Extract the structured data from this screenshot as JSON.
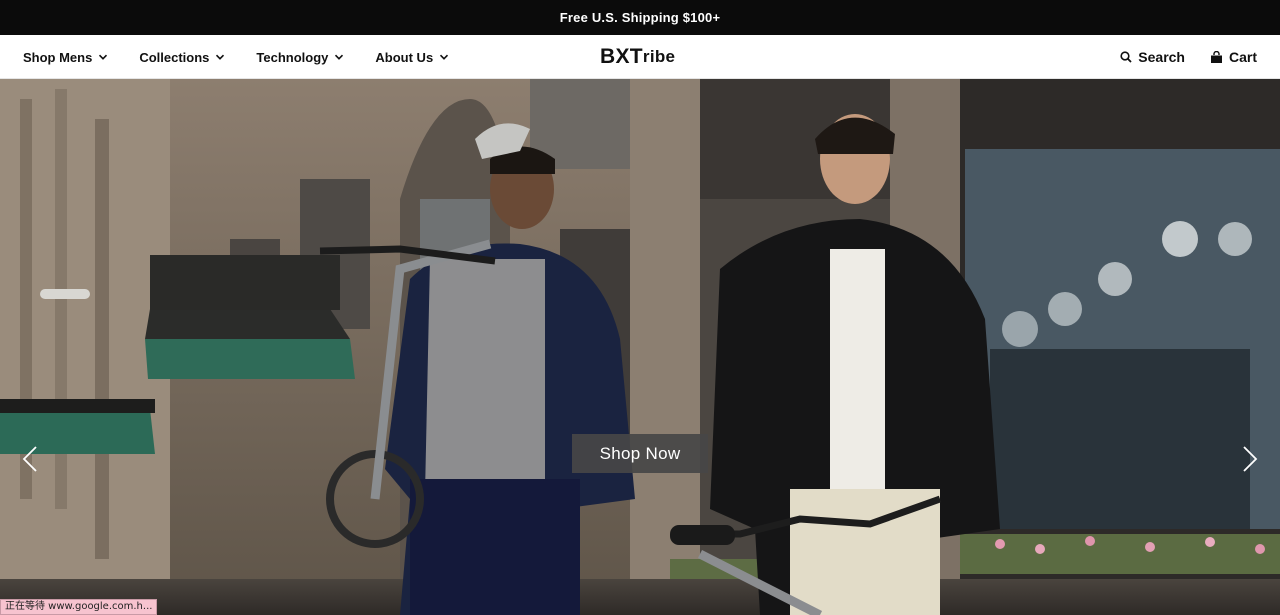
{
  "announcement": {
    "text": "Free U.S. Shipping $100+"
  },
  "nav": {
    "items": [
      {
        "label": "Shop Mens"
      },
      {
        "label": "Collections"
      },
      {
        "label": "Technology"
      },
      {
        "label": "About Us"
      }
    ]
  },
  "logo": {
    "part1": "BXT",
    "part2": "ribe"
  },
  "utility": {
    "search_label": "Search",
    "cart_label": "Cart"
  },
  "hero": {
    "cta_label": "Shop Now",
    "prev_icon": "chevron-left-icon",
    "next_icon": "chevron-right-icon"
  },
  "statusbar": {
    "text": "正在等待 www.google.com.h..."
  }
}
